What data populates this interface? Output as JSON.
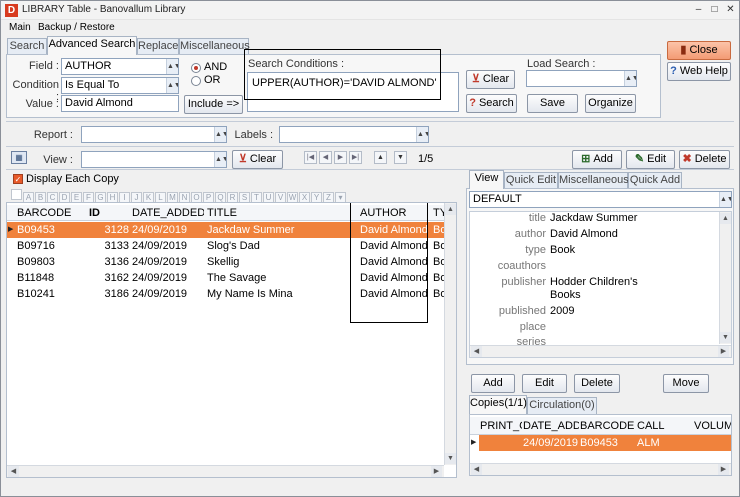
{
  "window": {
    "title": "LIBRARY Table - Banovallum Library",
    "logo": "D",
    "minimize": "–",
    "maximize": "□",
    "close": "✕"
  },
  "menu": [
    "Main",
    "Backup / Restore"
  ],
  "tabs": [
    "Search",
    "Advanced Search",
    "Replace",
    "Miscellaneous"
  ],
  "search": {
    "field_label": "Field :",
    "field_value": "AUTHOR",
    "condition_label": "Condition :",
    "condition_value": "Is Equal To",
    "value_label": "Value :",
    "value_value": "David Almond",
    "and_label": "AND",
    "or_label": "OR",
    "include_label": "Include =>",
    "conditions_label": "Search Conditions :",
    "conditions_value": "UPPER(AUTHOR)='DAVID ALMOND'",
    "clear_label": "Clear",
    "search_label": "Search",
    "load_search_label": "Load Search :",
    "save_label": "Save",
    "organize_label": "Organize"
  },
  "side_buttons": {
    "close_label": "Close",
    "help_label": "Web Help"
  },
  "filters": {
    "report_label": "Report :",
    "labels_label": "Labels :",
    "view_label": "View :",
    "clear_label": "Clear",
    "page_info": "1/5"
  },
  "record_buttons": {
    "add": "Add",
    "edit": "Edit",
    "delete": "Delete"
  },
  "display_each_copy": "Display Each Copy",
  "alphabet": [
    "A",
    "B",
    "C",
    "D",
    "E",
    "F",
    "G",
    "H",
    "I",
    "J",
    "K",
    "L",
    "M",
    "N",
    "O",
    "P",
    "Q",
    "R",
    "S",
    "T",
    "U",
    "V",
    "W",
    "X",
    "Y",
    "Z"
  ],
  "table": {
    "columns": [
      "BARCODE",
      "ID",
      "DATE_ADDED",
      "TITLE",
      "AUTHOR",
      "TY"
    ],
    "rows": [
      {
        "barcode": "B09453",
        "id": "3128",
        "date": "24/09/2019",
        "title": "Jackdaw Summer",
        "author": "David Almond",
        "type": "Bo"
      },
      {
        "barcode": "B09716",
        "id": "3133",
        "date": "24/09/2019",
        "title": "Slog's Dad",
        "author": "David Almond",
        "type": "Bo"
      },
      {
        "barcode": "B09803",
        "id": "3136",
        "date": "24/09/2019",
        "title": "Skellig",
        "author": "David Almond",
        "type": "Bo"
      },
      {
        "barcode": "B11848",
        "id": "3162",
        "date": "24/09/2019",
        "title": "The Savage",
        "author": "David Almond",
        "type": "Bo"
      },
      {
        "barcode": "B10241",
        "id": "3186",
        "date": "24/09/2019",
        "title": "My Name Is Mina",
        "author": "David Almond",
        "type": "Bo"
      }
    ]
  },
  "right_tabs": [
    "View",
    "Quick Edit",
    "Miscellaneous",
    "Quick Add"
  ],
  "view_select": "DEFAULT",
  "record": [
    {
      "k": "title",
      "v": "Jackdaw Summer"
    },
    {
      "k": "author",
      "v": "David Almond"
    },
    {
      "k": "type",
      "v": "Book"
    },
    {
      "k": "coauthors",
      "v": ""
    },
    {
      "k": "publisher",
      "v": "Hodder Children's"
    },
    {
      "k": "",
      "v": "Books"
    },
    {
      "k": "published",
      "v": "2009"
    },
    {
      "k": "place",
      "v": ""
    },
    {
      "k": "series",
      "v": ""
    }
  ],
  "copy_buttons": {
    "add": "Add",
    "edit": "Edit",
    "delete": "Delete",
    "move": "Move"
  },
  "copy_tabs": [
    "Copies(1/1)",
    "Circulation(0)"
  ],
  "copies": {
    "columns": [
      "PRINT_C",
      "DATE_ADDI",
      "BARCODE",
      "CALL",
      "VOLUMI"
    ],
    "rows": [
      {
        "print": "",
        "date": "24/09/2019",
        "barcode": "B09453",
        "call": "ALM",
        "volume": ""
      }
    ]
  },
  "colors": {
    "selection": "#f0823c",
    "close_button": "#f5a07a",
    "accent_red": "#d83a1e"
  }
}
